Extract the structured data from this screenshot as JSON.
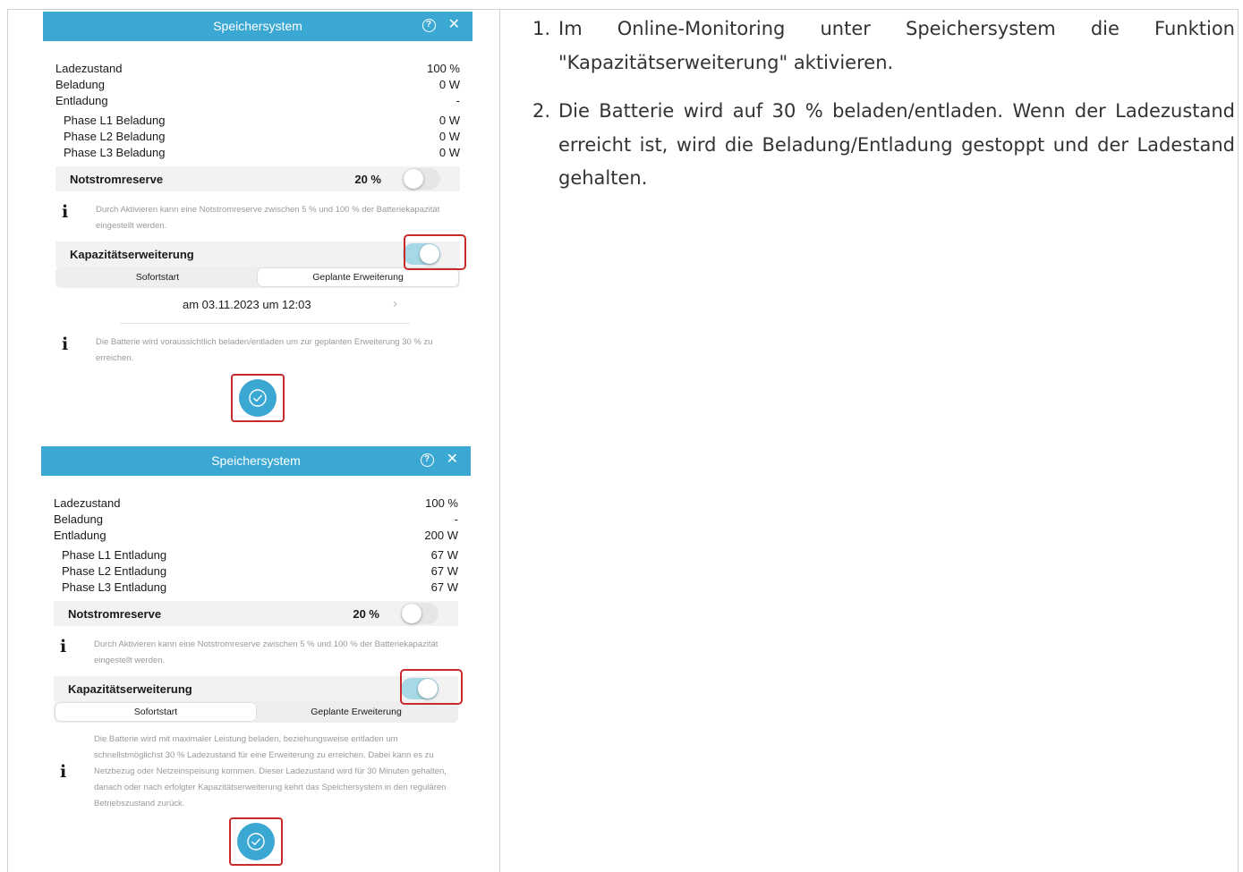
{
  "panels": [
    {
      "title": "Speichersystem",
      "status_rows": [
        {
          "label": "Ladezustand",
          "value": "100 %"
        },
        {
          "label": "Beladung",
          "value": "0 W"
        },
        {
          "label": "Entladung",
          "value": "-"
        }
      ],
      "phase_rows": [
        {
          "label": "Phase L1 Beladung",
          "value": "0 W"
        },
        {
          "label": "Phase L2 Beladung",
          "value": "0 W"
        },
        {
          "label": "Phase L3 Beladung",
          "value": "0 W"
        }
      ],
      "backup": {
        "label": "Notstromreserve",
        "percent": "20 %",
        "enabled": false
      },
      "backup_info": "Durch Aktivieren kann eine Notstromreserve zwischen 5 % und 100 % der Batteriekapazität eingestellt werden.",
      "capacity": {
        "label": "Kapazitätserweiterung",
        "enabled": true
      },
      "segments": {
        "options": [
          "Sofortstart",
          "Geplante Erweiterung"
        ],
        "selected": "Geplante Erweiterung"
      },
      "schedule": "am 03.11.2023 um 12:03",
      "capacity_info": "Die Batterie wird voraussichtlich beladen/entladen um zur geplanten Erweiterung 30 % zu erreichen."
    },
    {
      "title": "Speichersystem",
      "status_rows": [
        {
          "label": "Ladezustand",
          "value": "100 %"
        },
        {
          "label": "Beladung",
          "value": "-"
        },
        {
          "label": "Entladung",
          "value": "200 W"
        }
      ],
      "phase_rows": [
        {
          "label": "Phase L1 Entladung",
          "value": "67 W"
        },
        {
          "label": "Phase L2 Entladung",
          "value": "67 W"
        },
        {
          "label": "Phase L3 Entladung",
          "value": "67 W"
        }
      ],
      "backup": {
        "label": "Notstromreserve",
        "percent": "20 %",
        "enabled": false
      },
      "backup_info": "Durch Aktivieren kann eine Notstromreserve zwischen 5 % und 100 % der Batteriekapazität eingestellt werden.",
      "capacity": {
        "label": "Kapazitätserweiterung",
        "enabled": true
      },
      "segments": {
        "options": [
          "Sofortstart",
          "Geplante Erweiterung"
        ],
        "selected": "Sofortstart"
      },
      "capacity_info": "Die Batterie wird mit maximaler Leistung beladen, beziehungsweise entladen um schnellstmöglichst 30 % Ladezustand für eine Erweiterung zu erreichen. Dabei kann es zu Netzbezug oder Netzeinspeisung kommen. Dieser Ladezustand wird für 30 Minuten gehalten, danach oder nach erfolgter Kapazitätserweiterung kehrt das Speichersystem in den regulären Betriebszustand zurück."
    }
  ],
  "icons": {
    "help": "help-icon",
    "close": "close-icon",
    "info": "info-icon",
    "confirm": "checkmark-circle-icon",
    "chevron": "chevron-right-icon"
  },
  "colors": {
    "header": "#3ba8d4",
    "highlight": "#c92a2a",
    "toggle_on": "#a6d8e6"
  },
  "steps": [
    {
      "number": "1.",
      "text": "Im Online-Monitoring unter Speichersystem die Funktion \"Kapazitätserweiterung\" aktivieren."
    },
    {
      "number": "2.",
      "text": "Die Batterie wird auf 30 % beladen/entladen. Wenn der Ladezustand erreicht ist, wird die Beladung/Entladung gestoppt und der Ladestand gehalten."
    }
  ]
}
